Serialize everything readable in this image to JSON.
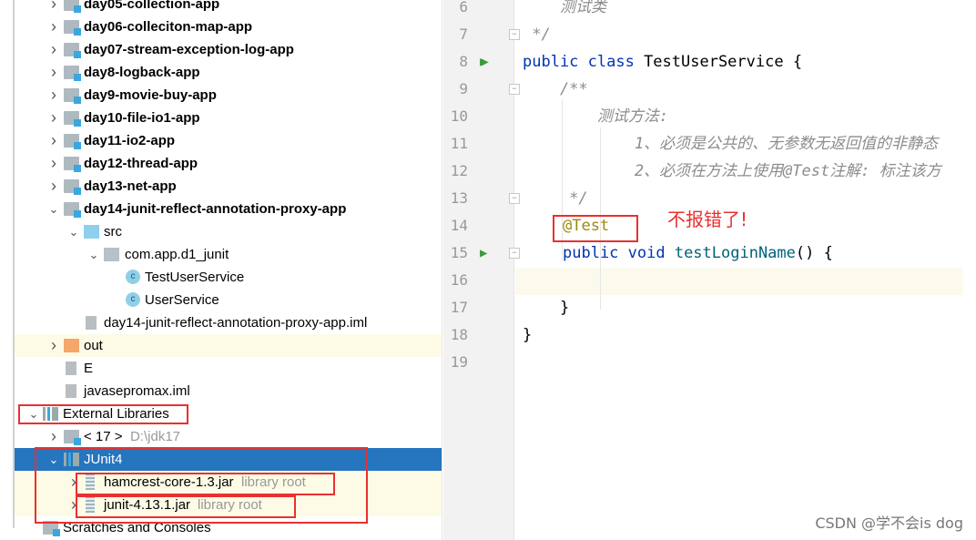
{
  "tree": {
    "items": [
      {
        "label": "day05-collection-app",
        "bold": true
      },
      {
        "label": "day06-colleciton-map-app",
        "bold": true
      },
      {
        "label": "day07-stream-exception-log-app",
        "bold": true
      },
      {
        "label": "day8-logback-app",
        "bold": true
      },
      {
        "label": "day9-movie-buy-app",
        "bold": true
      },
      {
        "label": "day10-file-io1-app",
        "bold": true
      },
      {
        "label": "day11-io2-app",
        "bold": true
      },
      {
        "label": "day12-thread-app",
        "bold": true
      },
      {
        "label": "day13-net-app",
        "bold": true
      },
      {
        "label": "day14-junit-reflect-annotation-proxy-app",
        "bold": true
      },
      {
        "label": "src"
      },
      {
        "label": "com.app.d1_junit"
      },
      {
        "label": "TestUserService"
      },
      {
        "label": "UserService"
      },
      {
        "label": "day14-junit-reflect-annotation-proxy-app.iml"
      },
      {
        "label": "out"
      },
      {
        "label": "E"
      },
      {
        "label": "javasepromax.iml"
      },
      {
        "label": "External Libraries"
      },
      {
        "label": "< 17 >",
        "hint": "D:\\jdk17"
      },
      {
        "label": "JUnit4"
      },
      {
        "label": "hamcrest-core-1.3.jar",
        "hint": "library root"
      },
      {
        "label": "junit-4.13.1.jar",
        "hint": "library root"
      },
      {
        "label": "Scratches and Consoles"
      }
    ]
  },
  "editor": {
    "lines": [
      {
        "n": "6",
        "text": "    测试类"
      },
      {
        "n": "7",
        "text": " */"
      },
      {
        "n": "8",
        "kw1": "public class ",
        "name": "TestUserService {"
      },
      {
        "n": "9",
        "text": "    /**"
      },
      {
        "n": "10",
        "text": "        测试方法:"
      },
      {
        "n": "11",
        "text": "            1、必须是公共的、无参数无返回值的非静态"
      },
      {
        "n": "12",
        "text": "            2、必须在方法上使用@Test注解: 标注该方"
      },
      {
        "n": "13",
        "text": "     */"
      },
      {
        "n": "14",
        "text": "@Test"
      },
      {
        "n": "15",
        "kw1": "public void ",
        "name": "testLoginName",
        "rest": "() {"
      },
      {
        "n": "16",
        "text": ""
      },
      {
        "n": "17",
        "text": "    }"
      },
      {
        "n": "18",
        "text": "}"
      },
      {
        "n": "19",
        "text": ""
      }
    ]
  },
  "annotation_note": "不报错了!",
  "watermark": "CSDN @学不会is dog",
  "colors": {
    "selection": "#2675bf",
    "highlight_box": "#e8312f",
    "keyword": "#0033b3",
    "annotation": "#9e880d"
  }
}
